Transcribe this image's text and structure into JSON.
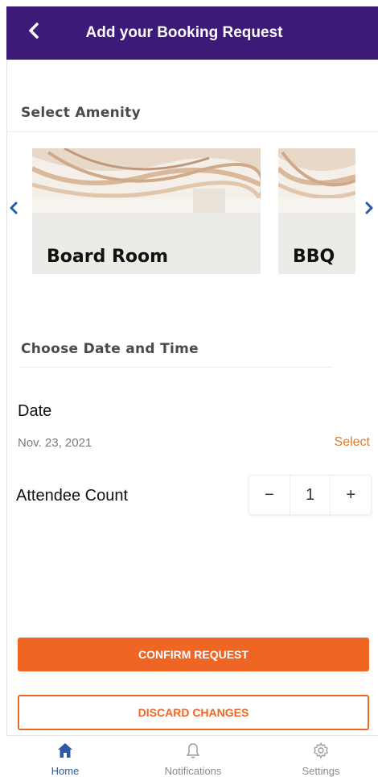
{
  "header": {
    "title": "Add your Booking Request"
  },
  "amenity_section": {
    "title": "Select Amenity"
  },
  "amenities": [
    {
      "label": "Board Room"
    },
    {
      "label": "BBQ"
    }
  ],
  "datetime_section": {
    "title": "Choose Date and Time"
  },
  "date": {
    "label": "Date",
    "value": "Nov. 23, 2021",
    "select_label": "Select"
  },
  "attendee": {
    "label": "Attendee Count",
    "minus": "−",
    "value": "1",
    "plus": "+"
  },
  "actions": {
    "confirm_label": "CONFIRM REQUEST",
    "discard_label": "DISCARD CHANGES"
  },
  "tabbar": {
    "items": [
      {
        "label": "Home",
        "icon": "home-icon",
        "active": true
      },
      {
        "label": "Notifications",
        "icon": "bell-icon",
        "active": false
      },
      {
        "label": "Settings",
        "icon": "gear-icon",
        "active": false
      }
    ]
  },
  "colors": {
    "header_bg": "#3b1a78",
    "accent": "#ef6524",
    "link": "#e07a2e",
    "tab_active": "#2c5aa8"
  }
}
